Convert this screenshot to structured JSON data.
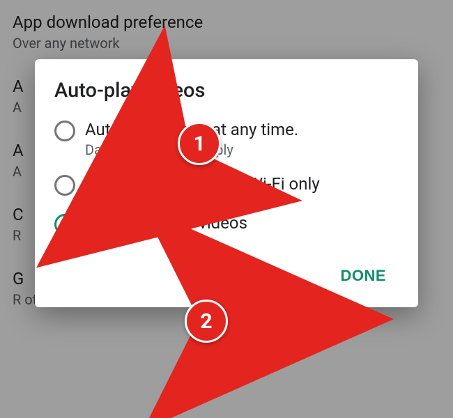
{
  "background_settings": {
    "items": [
      {
        "title": "App download preference",
        "subtitle": "Over any network",
        "key": "app-download-pref"
      },
      {
        "title": "A",
        "subtitle": "A",
        "key": "bg-item-2"
      },
      {
        "title": "A",
        "subtitle": "A",
        "key": "bg-item-3"
      },
      {
        "title": "C",
        "subtitle": "R",
        "key": "bg-item-4"
      },
      {
        "title": "G",
        "subtitle": "R other lists",
        "key": "bg-item-5"
      }
    ]
  },
  "dialog": {
    "title": "Auto-play videos",
    "options": [
      {
        "label": "Auto-play videos at any time.",
        "sublabel": "Data charges may apply",
        "selected": false,
        "key": "any-time"
      },
      {
        "label": "Auto-play videos over Wi-Fi only",
        "sublabel": "",
        "selected": false,
        "key": "wifi-only"
      },
      {
        "label": "Don't auto-play videos",
        "sublabel": "",
        "selected": true,
        "key": "dont-autoplay"
      }
    ],
    "done_label": "DONE"
  },
  "annotations": {
    "step1": "1",
    "step2": "2"
  },
  "colors": {
    "accent": "#0f8f6d",
    "annotation": "#e3241f"
  }
}
